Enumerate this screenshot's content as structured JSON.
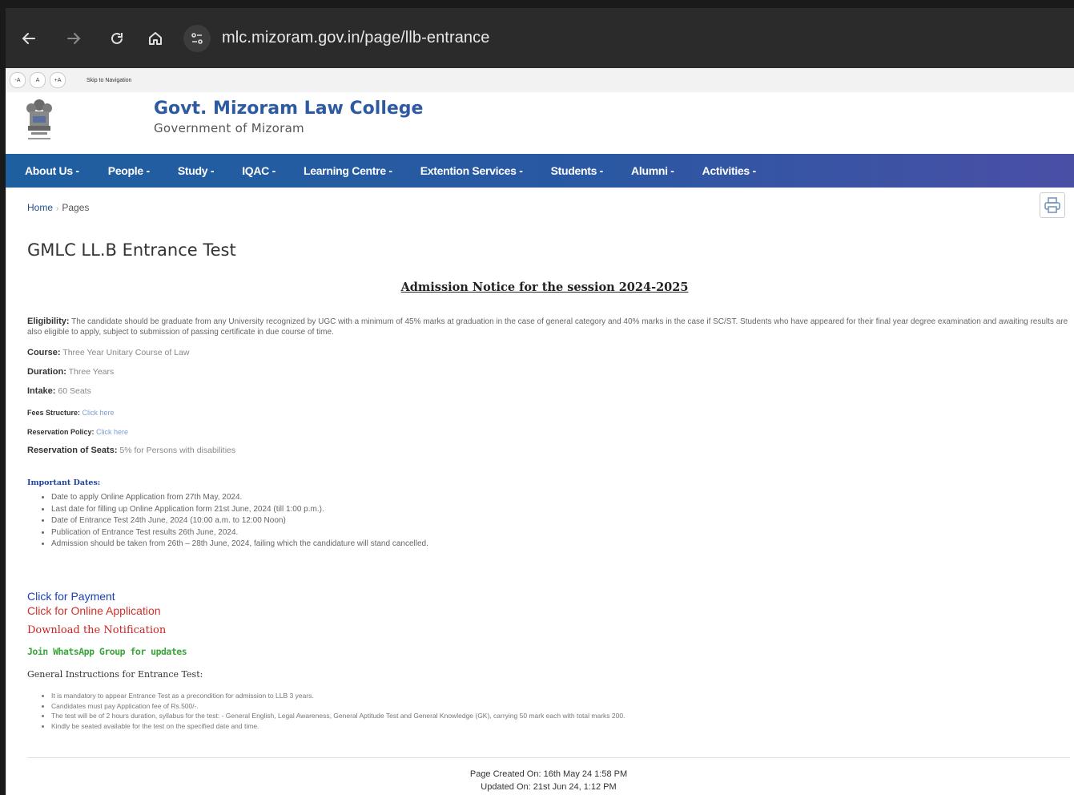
{
  "browser": {
    "url": "mlc.mizoram.gov.in/page/llb-entrance"
  },
  "accessibility": {
    "font_buttons": [
      "-A",
      "A",
      "+A"
    ],
    "skip_link": "Skip to Navigation"
  },
  "header": {
    "college_name": "Govt. Mizoram Law College",
    "government": "Government of Mizoram"
  },
  "menu": [
    "About Us -",
    "People -",
    "Study -",
    "IQAC -",
    "Learning Centre -",
    "Extention Services -",
    "Students -",
    "Alumni -",
    "Activities -"
  ],
  "breadcrumb": {
    "home": "Home",
    "current": "Pages"
  },
  "page_title": "GMLC LL.B Entrance Test",
  "notice_title": "Admission Notice for the session 2024-2025",
  "eligibility": {
    "label": "Eligibility:",
    "text": " The candidate should be graduate from any University recognized by UGC with a minimum of 45% marks at graduation in the case of general category and 40% marks in the case if SC/ST. Students who have appeared for their final year degree examination and awaiting results are also eligible to apply, subject to submission of passing certificate in due course of time."
  },
  "details": {
    "course_label": "Course:",
    "course_value": " Three Year Unitary Course of Law",
    "duration_label": "Duration:",
    "duration_value": " Three Years",
    "intake_label": "Intake:",
    "intake_value": " 60 Seats",
    "fees_label": "Fees Structure:",
    "fees_link": " Click here",
    "reservation_policy_label": "Reservation Policy:",
    "reservation_policy_link": " Click here",
    "reservation_seats_label": "Reservation of Seats:",
    "reservation_seats_value": " 5% for Persons with disabilities"
  },
  "important_dates": {
    "heading": "Important Dates:",
    "items": [
      "Date to apply Online Application from 27th May, 2024.",
      "Last date for filling up Online Application form 21st June, 2024 (till 1:00 p.m.).",
      "Date of Entrance Test 24th June, 2024 (10:00 a.m. to 12:00 Noon)",
      "Publication of Entrance Test results 26th June, 2024.",
      "Admission should be taken from 26th – 28th June, 2024, failing which the candidature will stand cancelled."
    ]
  },
  "links": {
    "payment": "Click for Payment",
    "application": "Click for Online Application",
    "notification": "Download the Notification",
    "whatsapp": "Join WhatsApp Group for updates"
  },
  "instructions": {
    "heading": "General Instructions for Entrance Test:",
    "items": [
      "It is mandatory to appear Entrance Test as a precondition for admission to LLB 3 years.",
      "Candidates must pay Application fee of Rs.500/-.",
      "The test will be of 2 hours duration, syllabus for the test: - General English, Legal Awareness, General Aptitude Test and General Knowledge (GK), carrying 50 mark each with total marks 200.",
      "Kindly be seated available for the test on the specified date and time."
    ]
  },
  "footer": {
    "created": "Page Created On: 16th May 24 1:58 PM",
    "updated": "Updated On: 21st Jun 24, 1:12 PM"
  }
}
